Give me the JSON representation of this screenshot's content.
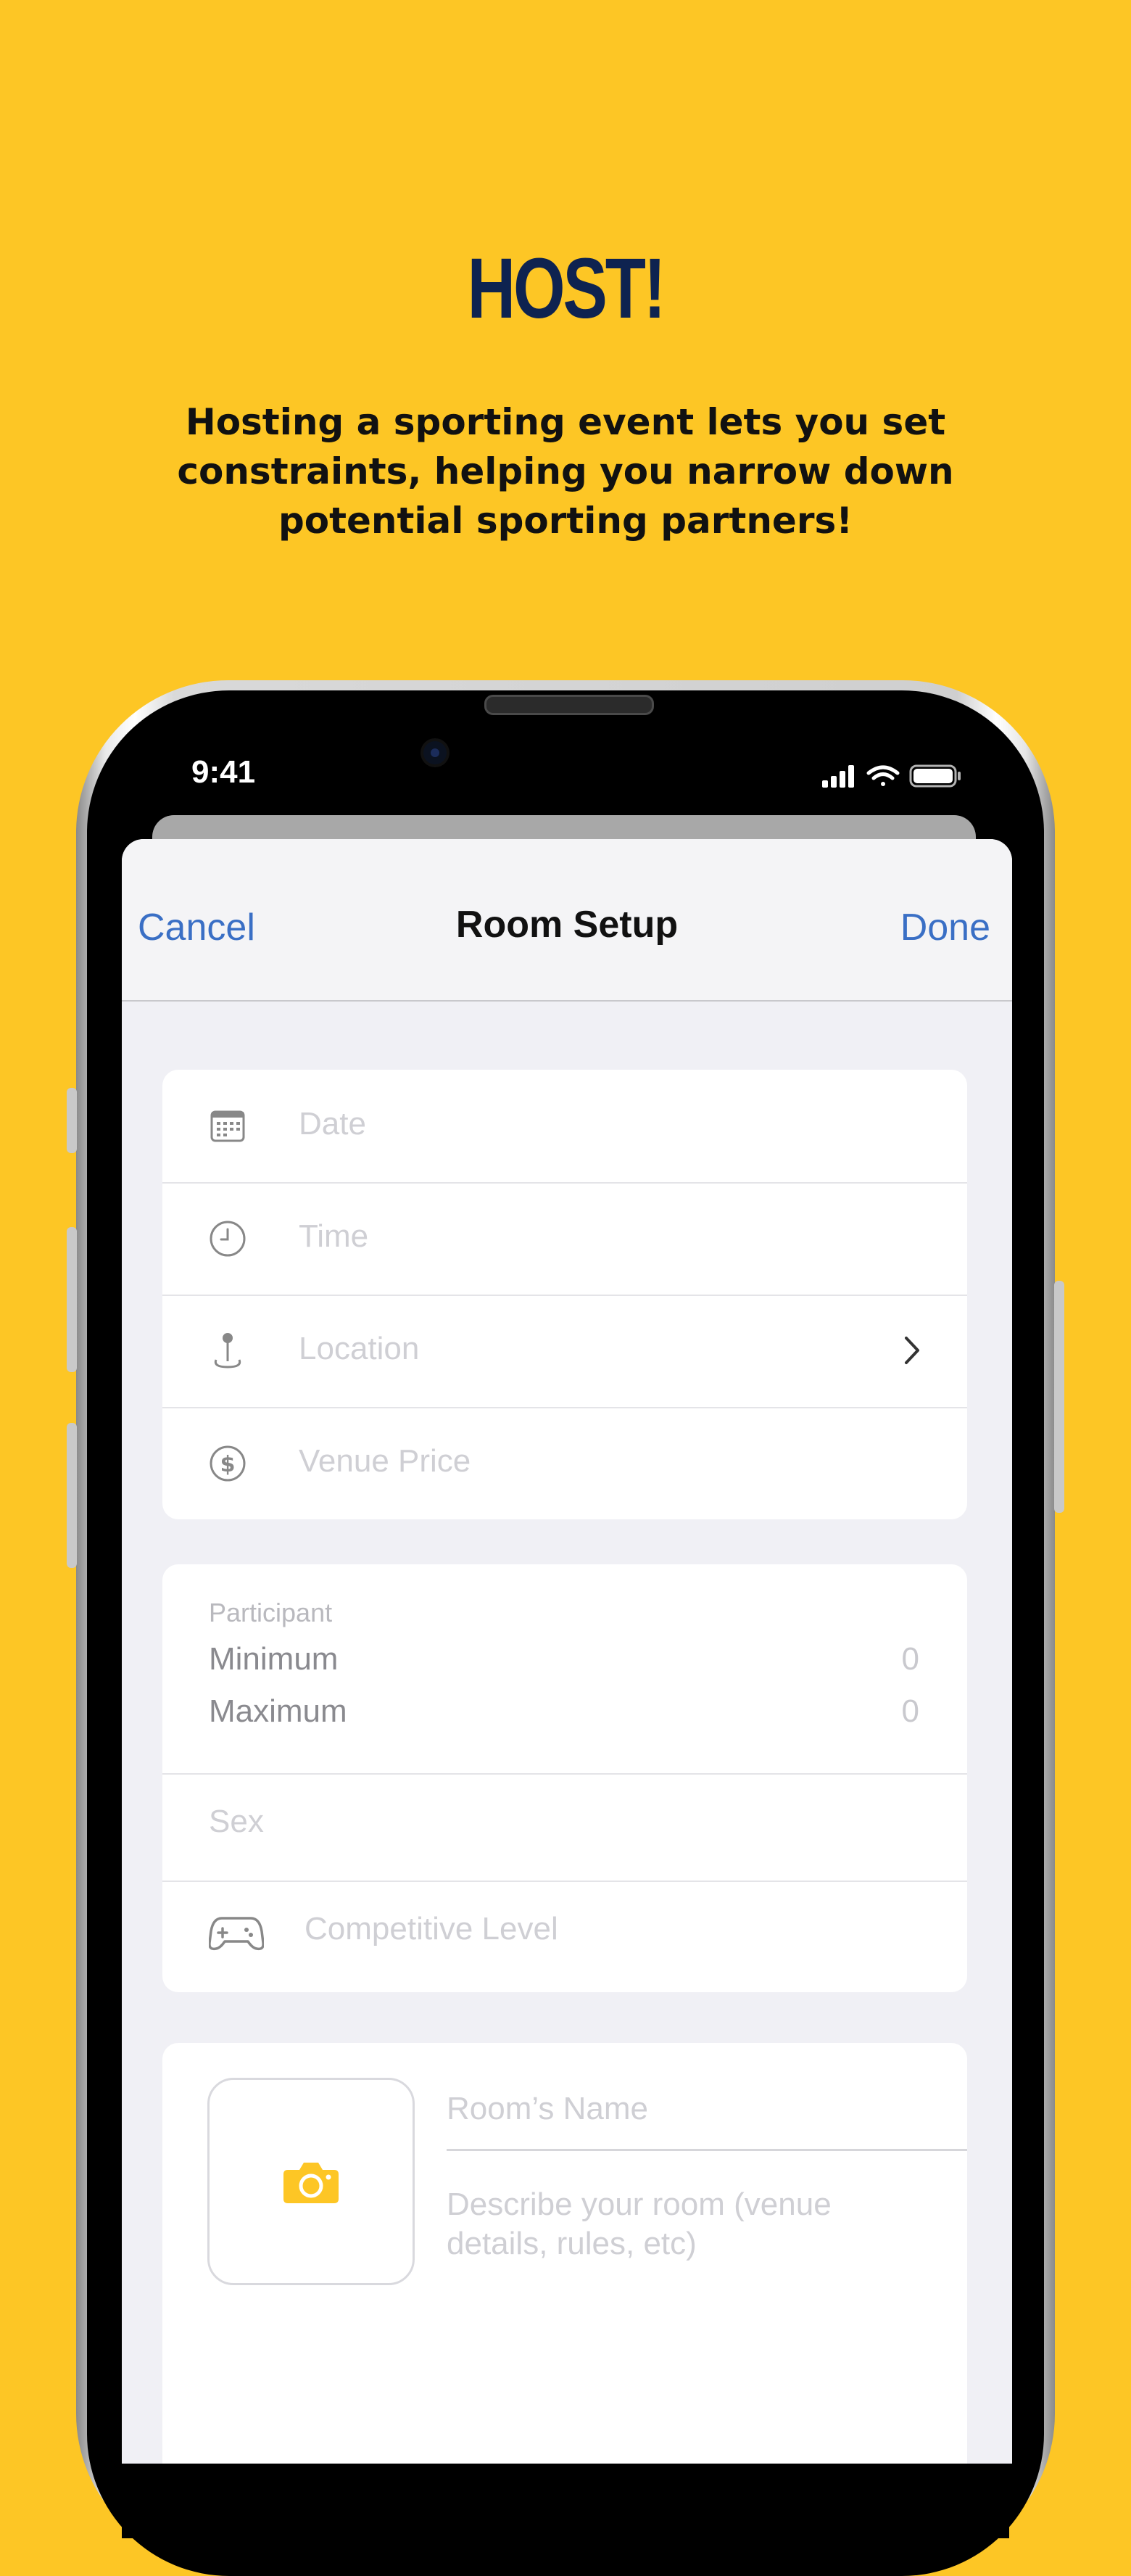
{
  "promo": {
    "headline": "HOST!",
    "subtitle": "Hosting a sporting event lets you set constraints, helping you narrow down potential sporting partners!"
  },
  "colors": {
    "background": "#fdc625",
    "headline": "#0e2350",
    "accent": "#3a6fc5"
  },
  "status_bar": {
    "time": "9:41",
    "icons": [
      "cellular-signal-icon",
      "wifi-icon",
      "battery-icon"
    ]
  },
  "navbar": {
    "cancel_label": "Cancel",
    "title": "Room Setup",
    "done_label": "Done"
  },
  "details": {
    "rows": [
      {
        "icon": "calendar-icon",
        "placeholder": "Date"
      },
      {
        "icon": "clock-icon",
        "placeholder": "Time"
      },
      {
        "icon": "location-pin-icon",
        "placeholder": "Location"
      },
      {
        "icon": "dollar-icon",
        "placeholder": "Venue Price"
      }
    ]
  },
  "participants": {
    "header": "Participant",
    "minimum_label": "Minimum",
    "minimum_value": "0",
    "maximum_label": "Maximum",
    "maximum_value": "0",
    "sex_placeholder": "Sex",
    "level_icon": "gamepad-icon",
    "level_placeholder": "Competitive Level"
  },
  "room": {
    "photo_icon": "camera-icon",
    "name_placeholder": "Room’s Name",
    "description_placeholder": "Describe your room (venue details, rules, etc)"
  }
}
